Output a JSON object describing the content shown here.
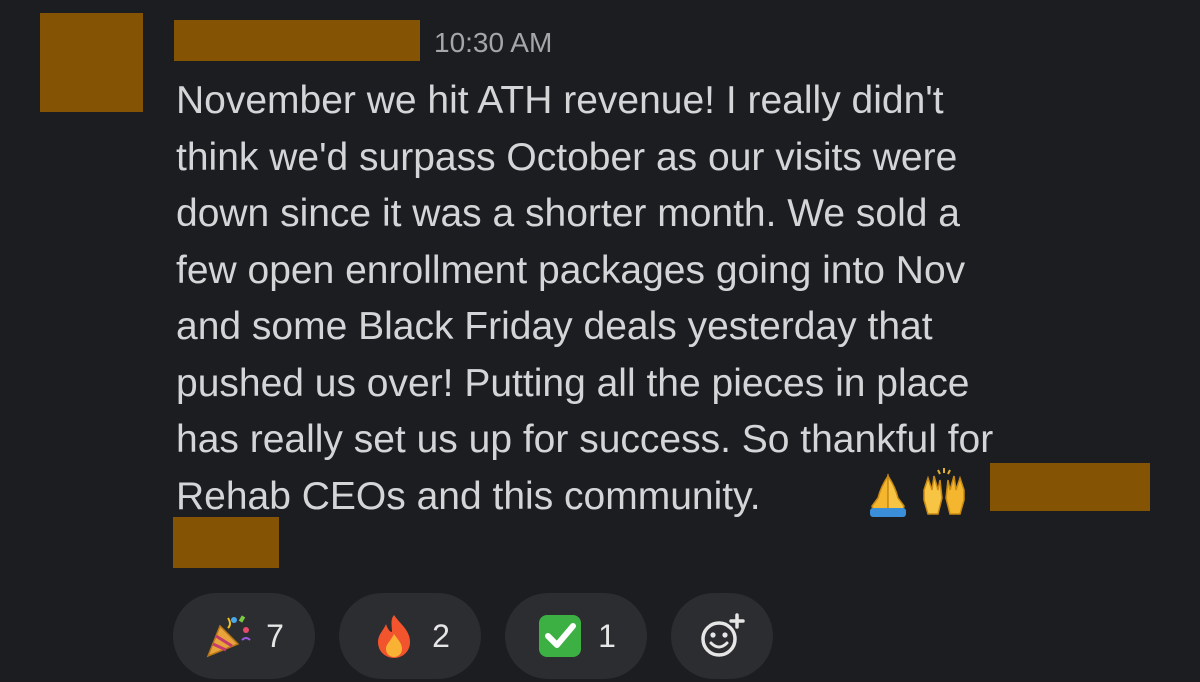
{
  "message": {
    "timestamp": "10:30 AM",
    "body": "November we hit ATH revenue! I really didn't\nthink we'd surpass October as our visits were\ndown since it was a shorter month. We sold a\nfew open enrollment packages going into Nov\nand some Black Friday deals yesterday that\npushed us over! Putting all the pieces in place\nhas really set us up for success. So thankful for\nRehab CEOs and this community."
  },
  "inline_emoji": [
    "folded-hands-icon",
    "raising-hands-icon"
  ],
  "reactions": [
    {
      "icon": "party-popper-icon",
      "count": "7"
    },
    {
      "icon": "fire-icon",
      "count": "2"
    },
    {
      "icon": "check-mark-button-icon",
      "count": "1"
    }
  ],
  "add_reaction_icon": "add-reaction-smiley-icon",
  "colors": {
    "background": "#1b1d21",
    "redaction": "#845404",
    "reaction_pill": "#2b2d31",
    "text": "#d4d5d6",
    "timestamp": "#a4a6a8"
  }
}
